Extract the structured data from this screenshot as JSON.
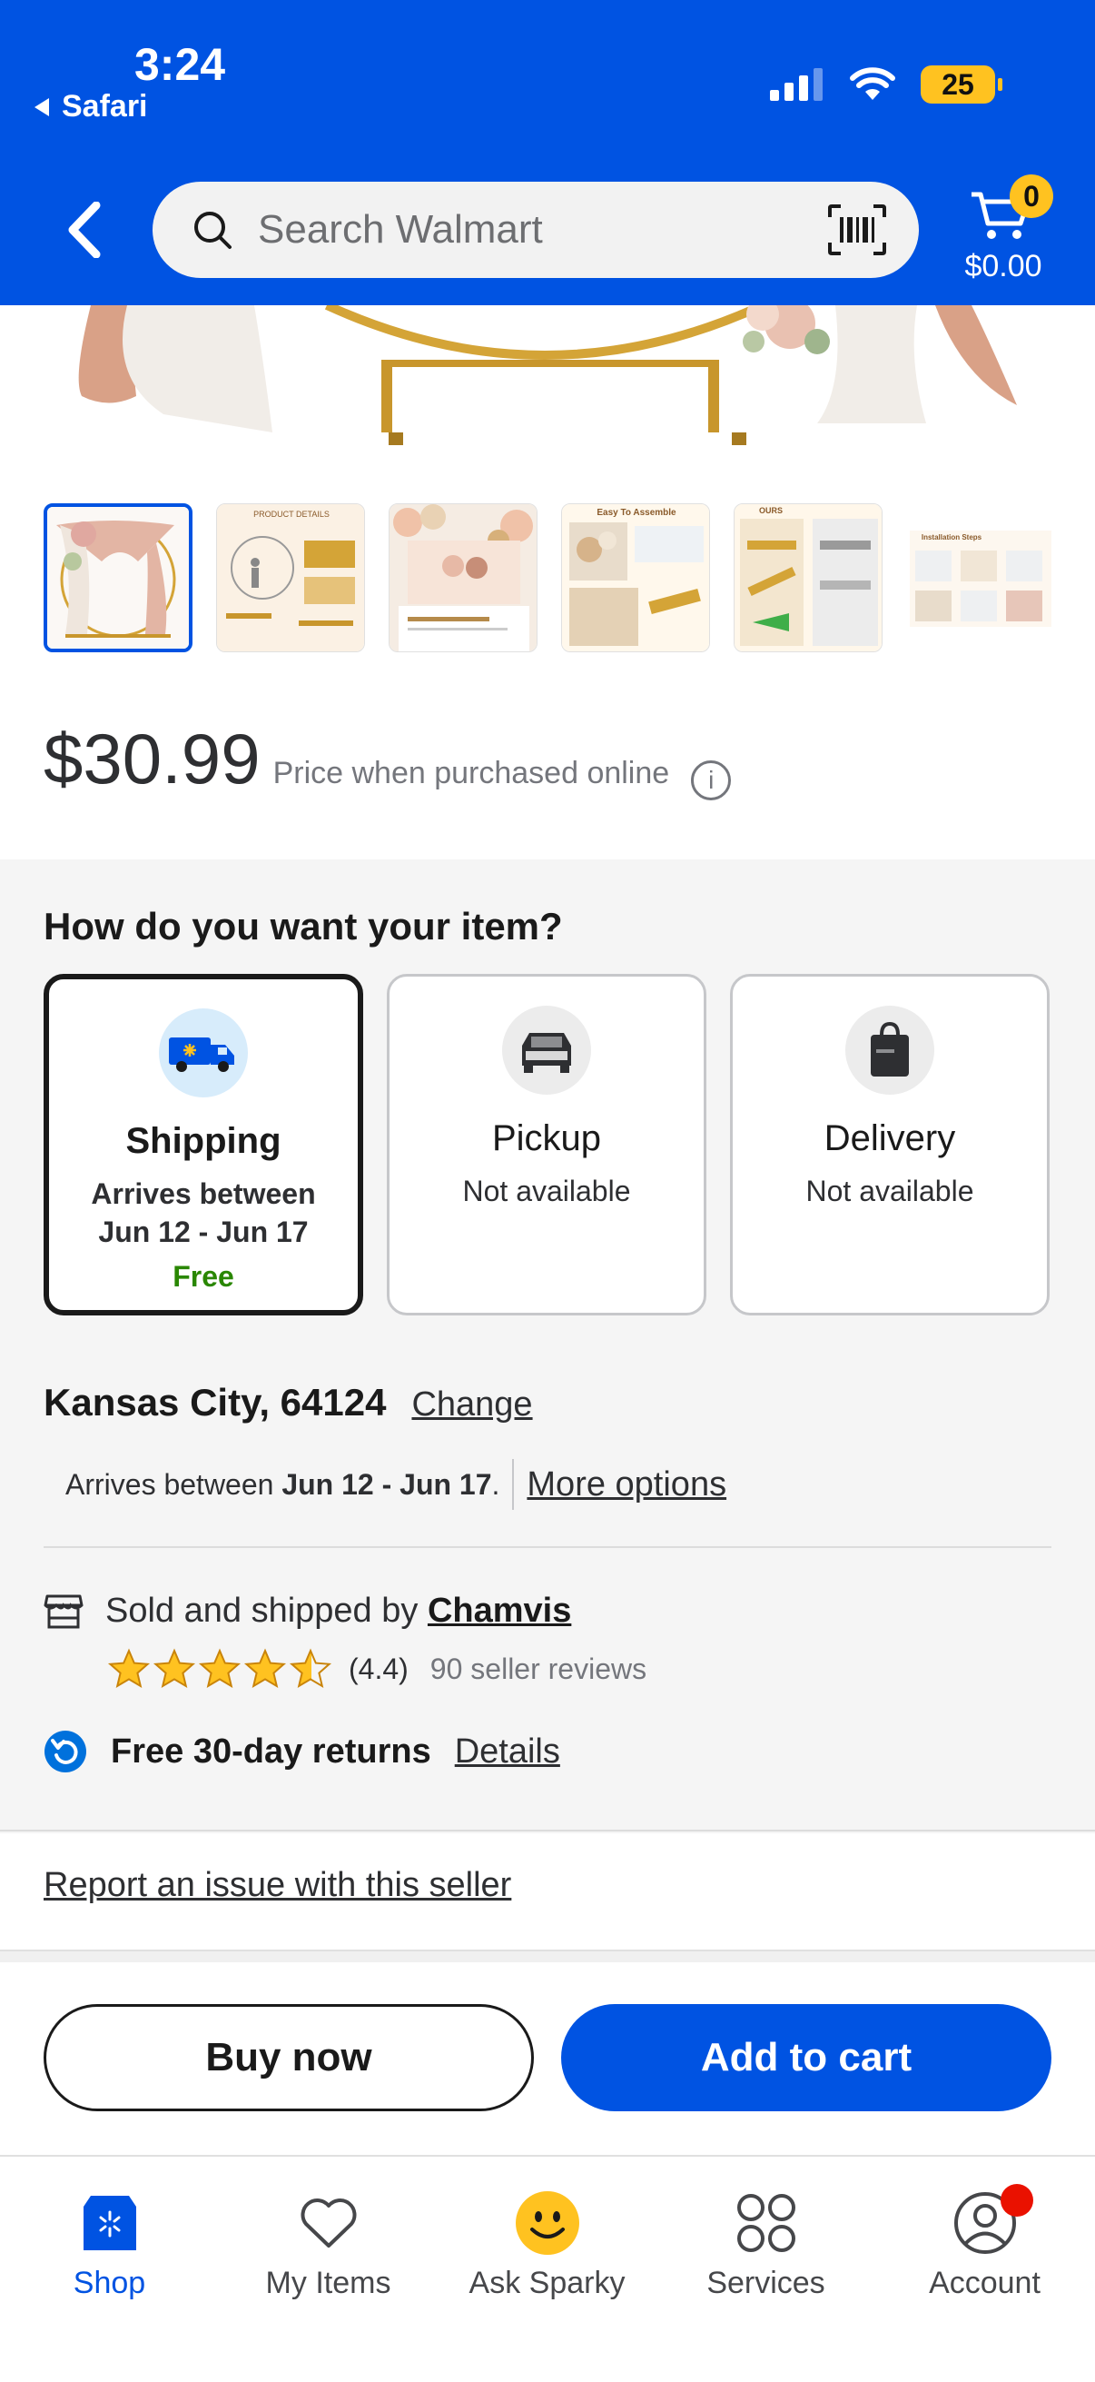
{
  "status_bar": {
    "time": "3:24",
    "back_app": "Safari",
    "battery": "25"
  },
  "header": {
    "search_placeholder": "Search Walmart",
    "cart_count": "0",
    "cart_total": "$0.00"
  },
  "product": {
    "price": "$30.99",
    "price_note": "Price when purchased online",
    "thumbnails": [
      {
        "label": ""
      },
      {
        "label": "PRODUCT DETAILS"
      },
      {
        "label": ""
      },
      {
        "label": "Easy To Assemble"
      },
      {
        "label": "OURS"
      },
      {
        "label": "Installation Steps"
      }
    ]
  },
  "fulfillment": {
    "title": "How do you want your item?",
    "options": [
      {
        "title": "Shipping",
        "line1": "Arrives between",
        "line2": "Jun 12 - Jun 17",
        "extra": "Free"
      },
      {
        "title": "Pickup",
        "line1": "Not available"
      },
      {
        "title": "Delivery",
        "line1": "Not available"
      }
    ],
    "location": "Kansas City, 64124",
    "change_label": "Change",
    "arrives_prefix": "Arrives between ",
    "arrives_dates": "Jun 12 - Jun 17",
    "arrives_suffix": ".",
    "more_options": "More options"
  },
  "seller": {
    "prefix": "Sold and shipped by ",
    "name": "Chamvis",
    "rating": "(4.4)",
    "rating_value": 4.4,
    "reviews": "90 seller reviews",
    "returns": "Free 30-day returns",
    "details_label": "Details"
  },
  "report_label": "Report an issue with this seller",
  "actions": {
    "buy_now": "Buy now",
    "add_to_cart": "Add to cart"
  },
  "nav": {
    "items": [
      {
        "label": "Shop",
        "icon": "store-icon"
      },
      {
        "label": "My Items",
        "icon": "heart-icon"
      },
      {
        "label": "Ask Sparky",
        "icon": "sparky-icon"
      },
      {
        "label": "Services",
        "icon": "grid-icon"
      },
      {
        "label": "Account",
        "icon": "account-icon"
      }
    ]
  },
  "colors": {
    "brand_blue": "#0053e2",
    "spark_yellow": "#ffc220",
    "free_green": "#2a8703"
  }
}
